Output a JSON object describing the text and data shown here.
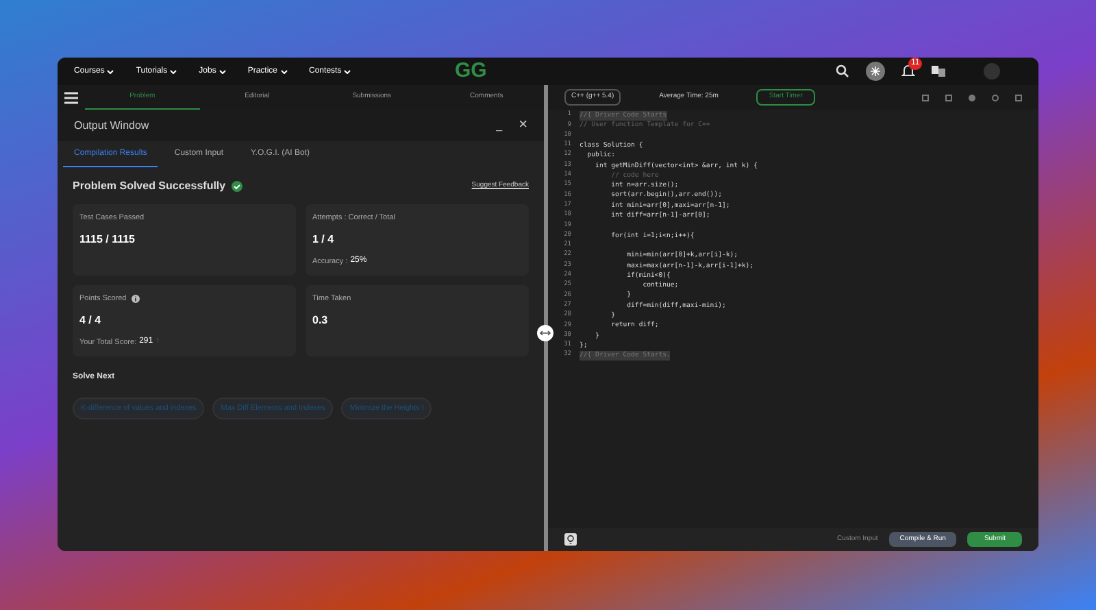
{
  "nav": {
    "menus": [
      "Courses",
      "Tutorials",
      "Jobs",
      "Practice",
      "Contests"
    ],
    "logo": "GG",
    "notification_count": "11"
  },
  "problem_tabs": [
    {
      "label": "Problem",
      "selected": true
    },
    {
      "label": "Editorial",
      "selected": false
    },
    {
      "label": "Submissions",
      "selected": false
    },
    {
      "label": "Comments",
      "selected": false
    }
  ],
  "output_window": {
    "title": "Output Window",
    "minimize": "_",
    "close": "×",
    "tabs": [
      {
        "label": "Compilation Results",
        "selected": true
      },
      {
        "label": "Custom Input",
        "selected": false
      },
      {
        "label": "Y.O.G.I. (AI Bot)",
        "selected": false
      }
    ],
    "status": "Problem Solved Successfully",
    "feedback_link": "Suggest Feedback",
    "cards": [
      {
        "label": "Test Cases Passed",
        "value": "1115 / 1115"
      },
      {
        "label": "Attempts : Correct / Total",
        "value": "1 / 4",
        "note_label": "Accuracy :",
        "note_value": "25%"
      },
      {
        "label": "Points Scored",
        "value": "4 / 4",
        "info": true,
        "note_label": "Your Total Score:",
        "note_value": "291",
        "trend": "↑"
      },
      {
        "label": "Time Taken",
        "value": "0.3"
      }
    ],
    "solve_next_title": "Solve Next",
    "solve_next": [
      "K-difference of values and indexes",
      "Max Diff Elements and Indexes",
      "Minimize the Heights I"
    ]
  },
  "editor": {
    "language": "C++ (g++ 5.4)",
    "average_time": "Average Time: 25m",
    "timer": "Start Timer",
    "lines": [
      {
        "n": "1",
        "kind": "folded",
        "text": "//{ Driver Code Starts"
      },
      {
        "n": "9",
        "kind": "comment",
        "text": "// User function Template for C++"
      },
      {
        "n": "10",
        "kind": "code"
      },
      {
        "n": "11",
        "kind": "code",
        "text": "class Solution {"
      },
      {
        "n": "12",
        "kind": "code",
        "text": "  public:"
      },
      {
        "n": "13",
        "kind": "code",
        "text": "    int getMinDiff(vector<int> &arr, int k) {"
      },
      {
        "n": "14",
        "kind": "comment",
        "text": "        // code here"
      },
      {
        "n": "15",
        "kind": "code",
        "text": "        int n=arr.size();"
      },
      {
        "n": "16",
        "kind": "code",
        "text": "        sort(arr.begin(),arr.end());"
      },
      {
        "n": "17",
        "kind": "code",
        "text": "        int mini=arr[0],maxi=arr[n-1];"
      },
      {
        "n": "18",
        "kind": "code",
        "text": "        int diff=arr[n-1]-arr[0];"
      },
      {
        "n": "19",
        "kind": "code"
      },
      {
        "n": "20",
        "kind": "code",
        "text": "        for(int i=1;i<n;i++){"
      },
      {
        "n": "21",
        "kind": "code"
      },
      {
        "n": "22",
        "kind": "code",
        "text": "            mini=min(arr[0]+k,arr[i]-k);"
      },
      {
        "n": "23",
        "kind": "code",
        "text": "            maxi=max(arr[n-1]-k,arr[i-1]+k);"
      },
      {
        "n": "24",
        "kind": "code",
        "text": "            if(mini<0){"
      },
      {
        "n": "25",
        "kind": "code",
        "text": "                continue;"
      },
      {
        "n": "26",
        "kind": "code",
        "text": "            }"
      },
      {
        "n": "27",
        "kind": "code",
        "text": "            diff=min(diff,maxi-mini);"
      },
      {
        "n": "28",
        "kind": "code",
        "text": "        }"
      },
      {
        "n": "29",
        "kind": "code",
        "text": "        return diff;"
      },
      {
        "n": "30",
        "kind": "code",
        "text": "    }"
      },
      {
        "n": "31",
        "kind": "code",
        "text": "};"
      },
      {
        "n": "32",
        "kind": "folded",
        "text": "//{ Driver Code Starts."
      }
    ],
    "custom_input": "Custom Input",
    "compile_button": "Compile & Run",
    "submit_button": "Submit"
  }
}
